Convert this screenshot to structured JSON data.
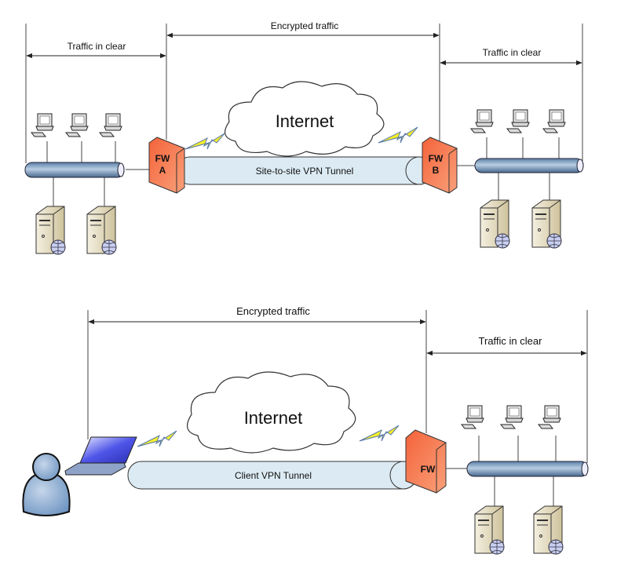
{
  "top": {
    "encrypted_label": "Encrypted traffic",
    "clear_left_label": "Traffic in clear",
    "clear_right_label": "Traffic in clear",
    "cloud_label": "Internet",
    "tunnel_label": "Site-to-site VPN Tunnel",
    "fw_a_label": [
      "FW",
      "A"
    ],
    "fw_b_label": [
      "FW",
      "B"
    ]
  },
  "bottom": {
    "encrypted_label": "Encrypted traffic",
    "clear_label": "Traffic in clear",
    "cloud_label": "Internet",
    "tunnel_label": "Client VPN Tunnel",
    "fw_label": "FW"
  },
  "colors": {
    "firewall": "#f26b3a",
    "tunnel": "#dcebf3",
    "bus": "#7fa2c6",
    "bolt": "#f5ee2a",
    "laptop_screen": "#3b3fd6",
    "user": "#8fb0d6"
  }
}
